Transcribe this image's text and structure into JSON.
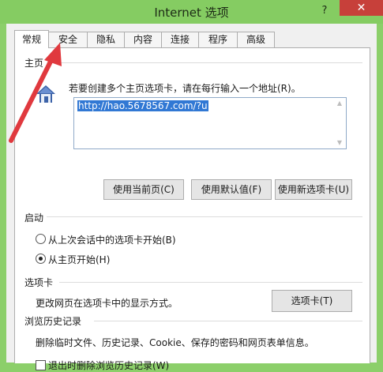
{
  "window": {
    "title": "Internet 选项",
    "help_label": "?",
    "close_label": "✕"
  },
  "tabs": [
    {
      "label": "常规",
      "active": true
    },
    {
      "label": "安全"
    },
    {
      "label": "隐私"
    },
    {
      "label": "内容"
    },
    {
      "label": "连接"
    },
    {
      "label": "程序"
    },
    {
      "label": "高级"
    }
  ],
  "home": {
    "section_label": "主页",
    "icon": "house-icon",
    "instruction": "若要创建多个主页选项卡，请在每行输入一个地址(R)。",
    "url_value": "http://hao.5678567.com/?u",
    "buttons": {
      "use_current": "使用当前页(C)",
      "use_default": "使用默认值(F)",
      "use_new_tab": "使用新选项卡(U)"
    }
  },
  "startup": {
    "section_label": "启动",
    "options": [
      {
        "label": "从上次会话中的选项卡开始(B)",
        "checked": false
      },
      {
        "label": "从主页开始(H)",
        "checked": true
      }
    ]
  },
  "tabs_section": {
    "section_label": "选项卡",
    "description": "更改网页在选项卡中的显示方式。",
    "button": "选项卡(T)"
  },
  "history": {
    "section_label": "浏览历史记录",
    "description": "删除临时文件、历史记录、Cookie、保存的密码和网页表单信息。",
    "checkbox_label": "退出时删除浏览历史记录(W)",
    "checkbox_checked": false
  },
  "colors": {
    "titlebar": "#85cc62",
    "close": "#c7403a",
    "annotation_arrow": "#e0393e",
    "selection": "#3178d4"
  }
}
